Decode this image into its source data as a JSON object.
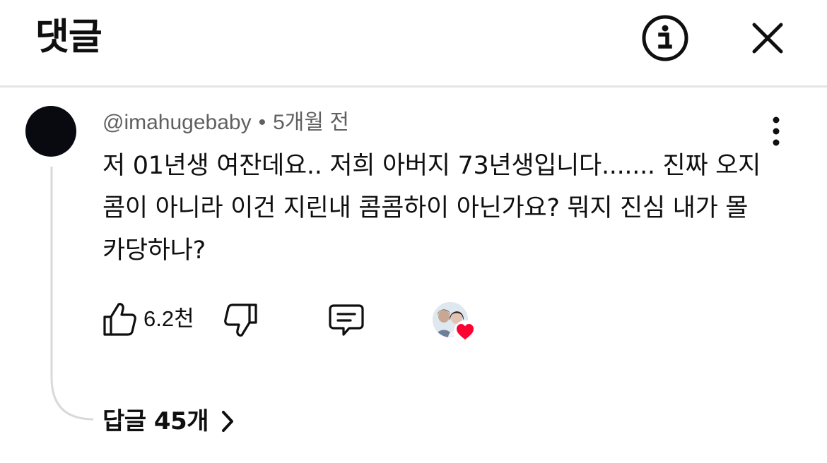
{
  "header": {
    "title": "댓글",
    "info_icon": "info-circle-icon",
    "close_icon": "close-icon"
  },
  "comment": {
    "author": "@imahugebaby",
    "separator": "•",
    "time": "5개월 전",
    "text": "저 01년생 여잔데요.. 저희 아버지 73년생입니다....... 진짜 오지콤이 아니라 이건 지린내 콤콤하이 아닌가요? 뭐지 진심 내가 몰카당하나?",
    "like_count": "6.2천",
    "replies_label": "답글 45개"
  },
  "colors": {
    "text_primary": "#0f0f0f",
    "text_secondary": "#606060",
    "divider": "#e5e5e5",
    "thread_line": "#d9d9d9",
    "heart": "#ff0033",
    "avatar": "#080a0f"
  },
  "icons": {
    "like": "thumbs-up-icon",
    "dislike": "thumbs-down-icon",
    "reply": "comment-icon",
    "more": "more-vertical-icon",
    "heart": "heart-icon",
    "chevron": "chevron-right-icon"
  }
}
